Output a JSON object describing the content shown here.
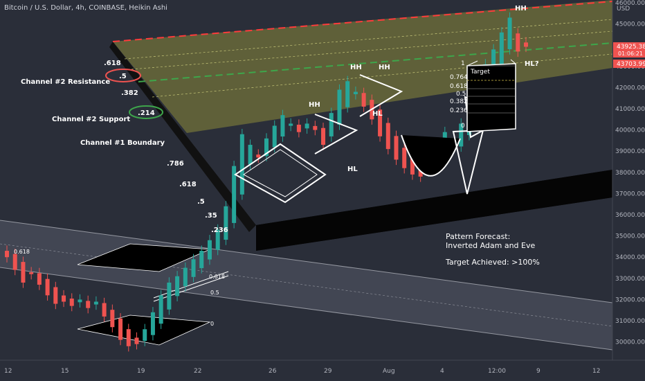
{
  "header": {
    "title": "Bitcoin / U.S. Dollar, 4h, COINBASE, Heikin Ashi",
    "currency": "USD"
  },
  "colors": {
    "background": "#2a2e39",
    "bull": "#26a69a",
    "bear": "#ef5350",
    "channel_fill": "#8a8a3a",
    "resistance_line": "#ff3b3b",
    "support_line": "#3ea64b"
  },
  "price_badges": {
    "current": "43925.38",
    "countdown": "01:06:21",
    "level": "43703.99"
  },
  "channel_labels": {
    "resistance": "Channel #2 Resistance",
    "support": "Channel #2 Support",
    "boundary": "Channel #1 Boundary"
  },
  "fib_left": [
    ".618",
    ".5",
    ".382",
    ".214",
    ".786",
    ".618",
    ".5",
    ".35",
    ".236"
  ],
  "fib_target": [
    "1",
    "0.764",
    "0.618",
    "0.5",
    "0.382",
    "0.236",
    "0"
  ],
  "fib_small": [
    "0.618",
    "0.618",
    "0.5",
    "0"
  ],
  "target_label": "Target",
  "swing_labels": [
    "HH",
    "HH",
    "HH",
    "HL",
    "HL",
    "HH",
    "HL?"
  ],
  "notes": {
    "line1": "Pattern Forecast:",
    "line2": "Inverted Adam and Eve",
    "line3": "Target Achieved: >100%"
  },
  "chart_data": {
    "type": "candlestick",
    "title": "Bitcoin / U.S. Dollar, 4h, COINBASE, Heikin Ashi",
    "y_ticks": [
      30000,
      31000,
      32000,
      33000,
      34000,
      35000,
      36000,
      37000,
      38000,
      39000,
      40000,
      41000,
      42000,
      43000,
      44000,
      45000,
      46000
    ],
    "y_tick_labels": [
      "30000.00",
      "31000.00",
      "32000.00",
      "33000.00",
      "34000.00",
      "35000.00",
      "36000.00",
      "37000.00",
      "38000.00",
      "39000.00",
      "40000.00",
      "41000.00",
      "42000.00",
      "43000.00",
      "44000.00",
      "45000.00",
      "46000.00"
    ],
    "ylim": [
      29400,
      46000
    ],
    "x_ticks": [
      "12",
      "15",
      "19",
      "22",
      "26",
      "29",
      "Aug",
      "4",
      "12:00",
      "9",
      "12"
    ],
    "series": [
      {
        "name": "close",
        "values": [
          34000,
          33400,
          32800,
          33200,
          32700,
          32200,
          31800,
          31900,
          31700,
          32000,
          31600,
          31900,
          31200,
          30700,
          30100,
          29800,
          29900,
          30600,
          31400,
          32200,
          32800,
          33100,
          33500,
          33900,
          34300,
          34800,
          35300,
          36400,
          38300,
          39800,
          39300,
          38700,
          39600,
          40200,
          40700,
          40300,
          39900,
          40300,
          40000,
          39300,
          40800,
          41900,
          42300,
          41800,
          41100,
          40500,
          39700,
          39100,
          38600,
          38200,
          37900,
          37800,
          38300,
          39400,
          39900,
          39100,
          40300,
          41300,
          42200,
          43100,
          43800,
          44600,
          45300,
          43700,
          43925
        ]
      }
    ]
  }
}
